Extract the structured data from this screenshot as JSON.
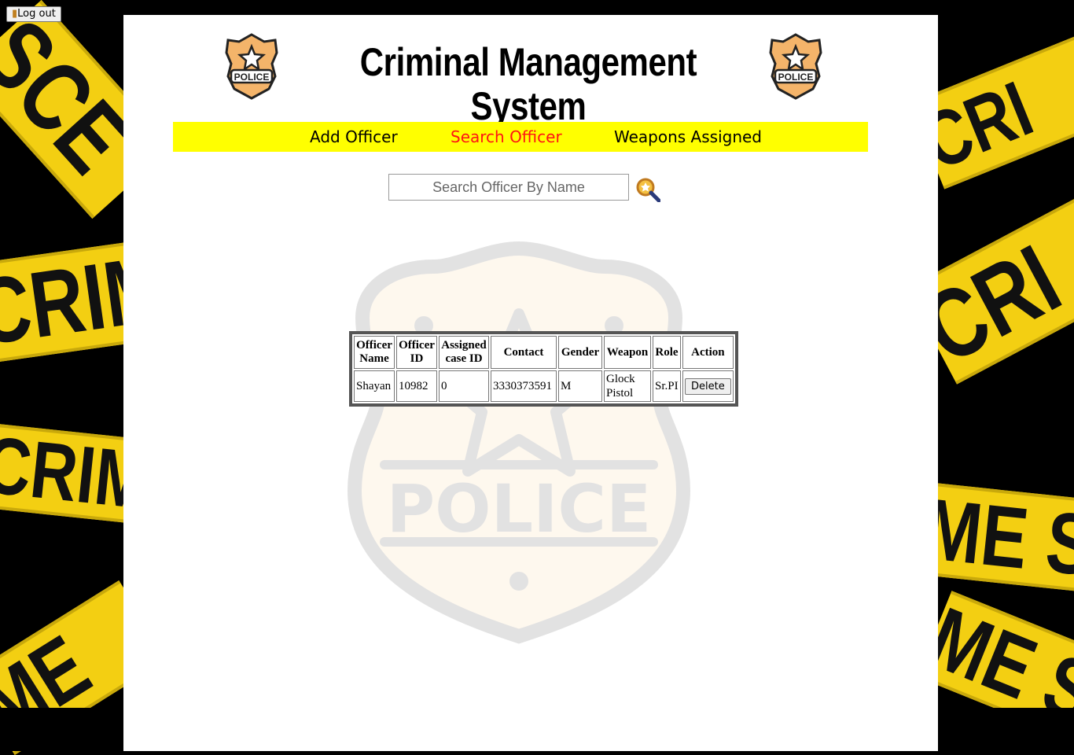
{
  "app": {
    "logout_label": "Log out",
    "title": "Criminal Management System",
    "badge_text": "POLICE"
  },
  "nav": {
    "items": [
      {
        "label": "Add Officer",
        "active": false
      },
      {
        "label": "Search Officer",
        "active": true
      },
      {
        "label": "Weapons Assigned",
        "active": false
      }
    ]
  },
  "search": {
    "placeholder": "Search Officer By Name",
    "value": ""
  },
  "table": {
    "headers": [
      "Officer Name",
      "Officer ID",
      "Assigned case ID",
      "Contact",
      "Gender",
      "Weapon",
      "Role",
      "Action"
    ],
    "rows": [
      {
        "name": "Shayan",
        "id": "10982",
        "case_id": "0",
        "contact": "3330373591",
        "gender": "M",
        "weapon": "Glock Pistol",
        "role": "Sr.PI",
        "action": "Delete"
      }
    ]
  },
  "background": {
    "tape_words": [
      "SCE",
      "CRIM",
      "CRIME",
      "ME",
      "CRI",
      "CRI",
      "ME SC",
      "ME S"
    ]
  },
  "watermark": {
    "text": "POLICE"
  },
  "colors": {
    "nav_bg": "#ffff00",
    "nav_active": "#ff1414",
    "tape": "#f3cf12",
    "badge": "#f4b46a"
  }
}
